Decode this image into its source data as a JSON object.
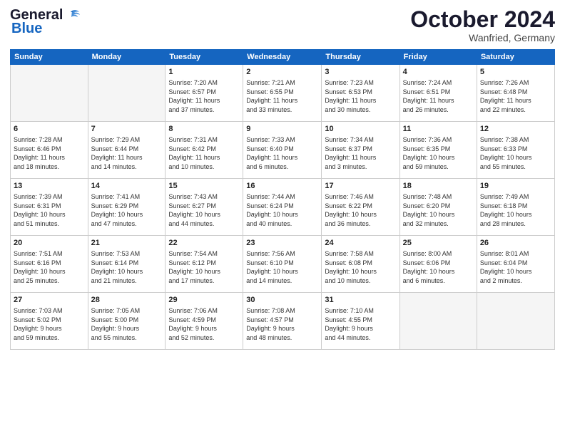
{
  "logo": {
    "line1": "General",
    "line2": "Blue"
  },
  "title": "October 2024",
  "location": "Wanfried, Germany",
  "headers": [
    "Sunday",
    "Monday",
    "Tuesday",
    "Wednesday",
    "Thursday",
    "Friday",
    "Saturday"
  ],
  "rows": [
    [
      {
        "day": "",
        "detail": ""
      },
      {
        "day": "",
        "detail": ""
      },
      {
        "day": "1",
        "detail": "Sunrise: 7:20 AM\nSunset: 6:57 PM\nDaylight: 11 hours\nand 37 minutes."
      },
      {
        "day": "2",
        "detail": "Sunrise: 7:21 AM\nSunset: 6:55 PM\nDaylight: 11 hours\nand 33 minutes."
      },
      {
        "day": "3",
        "detail": "Sunrise: 7:23 AM\nSunset: 6:53 PM\nDaylight: 11 hours\nand 30 minutes."
      },
      {
        "day": "4",
        "detail": "Sunrise: 7:24 AM\nSunset: 6:51 PM\nDaylight: 11 hours\nand 26 minutes."
      },
      {
        "day": "5",
        "detail": "Sunrise: 7:26 AM\nSunset: 6:48 PM\nDaylight: 11 hours\nand 22 minutes."
      }
    ],
    [
      {
        "day": "6",
        "detail": "Sunrise: 7:28 AM\nSunset: 6:46 PM\nDaylight: 11 hours\nand 18 minutes."
      },
      {
        "day": "7",
        "detail": "Sunrise: 7:29 AM\nSunset: 6:44 PM\nDaylight: 11 hours\nand 14 minutes."
      },
      {
        "day": "8",
        "detail": "Sunrise: 7:31 AM\nSunset: 6:42 PM\nDaylight: 11 hours\nand 10 minutes."
      },
      {
        "day": "9",
        "detail": "Sunrise: 7:33 AM\nSunset: 6:40 PM\nDaylight: 11 hours\nand 6 minutes."
      },
      {
        "day": "10",
        "detail": "Sunrise: 7:34 AM\nSunset: 6:37 PM\nDaylight: 11 hours\nand 3 minutes."
      },
      {
        "day": "11",
        "detail": "Sunrise: 7:36 AM\nSunset: 6:35 PM\nDaylight: 10 hours\nand 59 minutes."
      },
      {
        "day": "12",
        "detail": "Sunrise: 7:38 AM\nSunset: 6:33 PM\nDaylight: 10 hours\nand 55 minutes."
      }
    ],
    [
      {
        "day": "13",
        "detail": "Sunrise: 7:39 AM\nSunset: 6:31 PM\nDaylight: 10 hours\nand 51 minutes."
      },
      {
        "day": "14",
        "detail": "Sunrise: 7:41 AM\nSunset: 6:29 PM\nDaylight: 10 hours\nand 47 minutes."
      },
      {
        "day": "15",
        "detail": "Sunrise: 7:43 AM\nSunset: 6:27 PM\nDaylight: 10 hours\nand 44 minutes."
      },
      {
        "day": "16",
        "detail": "Sunrise: 7:44 AM\nSunset: 6:24 PM\nDaylight: 10 hours\nand 40 minutes."
      },
      {
        "day": "17",
        "detail": "Sunrise: 7:46 AM\nSunset: 6:22 PM\nDaylight: 10 hours\nand 36 minutes."
      },
      {
        "day": "18",
        "detail": "Sunrise: 7:48 AM\nSunset: 6:20 PM\nDaylight: 10 hours\nand 32 minutes."
      },
      {
        "day": "19",
        "detail": "Sunrise: 7:49 AM\nSunset: 6:18 PM\nDaylight: 10 hours\nand 28 minutes."
      }
    ],
    [
      {
        "day": "20",
        "detail": "Sunrise: 7:51 AM\nSunset: 6:16 PM\nDaylight: 10 hours\nand 25 minutes."
      },
      {
        "day": "21",
        "detail": "Sunrise: 7:53 AM\nSunset: 6:14 PM\nDaylight: 10 hours\nand 21 minutes."
      },
      {
        "day": "22",
        "detail": "Sunrise: 7:54 AM\nSunset: 6:12 PM\nDaylight: 10 hours\nand 17 minutes."
      },
      {
        "day": "23",
        "detail": "Sunrise: 7:56 AM\nSunset: 6:10 PM\nDaylight: 10 hours\nand 14 minutes."
      },
      {
        "day": "24",
        "detail": "Sunrise: 7:58 AM\nSunset: 6:08 PM\nDaylight: 10 hours\nand 10 minutes."
      },
      {
        "day": "25",
        "detail": "Sunrise: 8:00 AM\nSunset: 6:06 PM\nDaylight: 10 hours\nand 6 minutes."
      },
      {
        "day": "26",
        "detail": "Sunrise: 8:01 AM\nSunset: 6:04 PM\nDaylight: 10 hours\nand 2 minutes."
      }
    ],
    [
      {
        "day": "27",
        "detail": "Sunrise: 7:03 AM\nSunset: 5:02 PM\nDaylight: 9 hours\nand 59 minutes."
      },
      {
        "day": "28",
        "detail": "Sunrise: 7:05 AM\nSunset: 5:00 PM\nDaylight: 9 hours\nand 55 minutes."
      },
      {
        "day": "29",
        "detail": "Sunrise: 7:06 AM\nSunset: 4:59 PM\nDaylight: 9 hours\nand 52 minutes."
      },
      {
        "day": "30",
        "detail": "Sunrise: 7:08 AM\nSunset: 4:57 PM\nDaylight: 9 hours\nand 48 minutes."
      },
      {
        "day": "31",
        "detail": "Sunrise: 7:10 AM\nSunset: 4:55 PM\nDaylight: 9 hours\nand 44 minutes."
      },
      {
        "day": "",
        "detail": ""
      },
      {
        "day": "",
        "detail": ""
      }
    ]
  ]
}
